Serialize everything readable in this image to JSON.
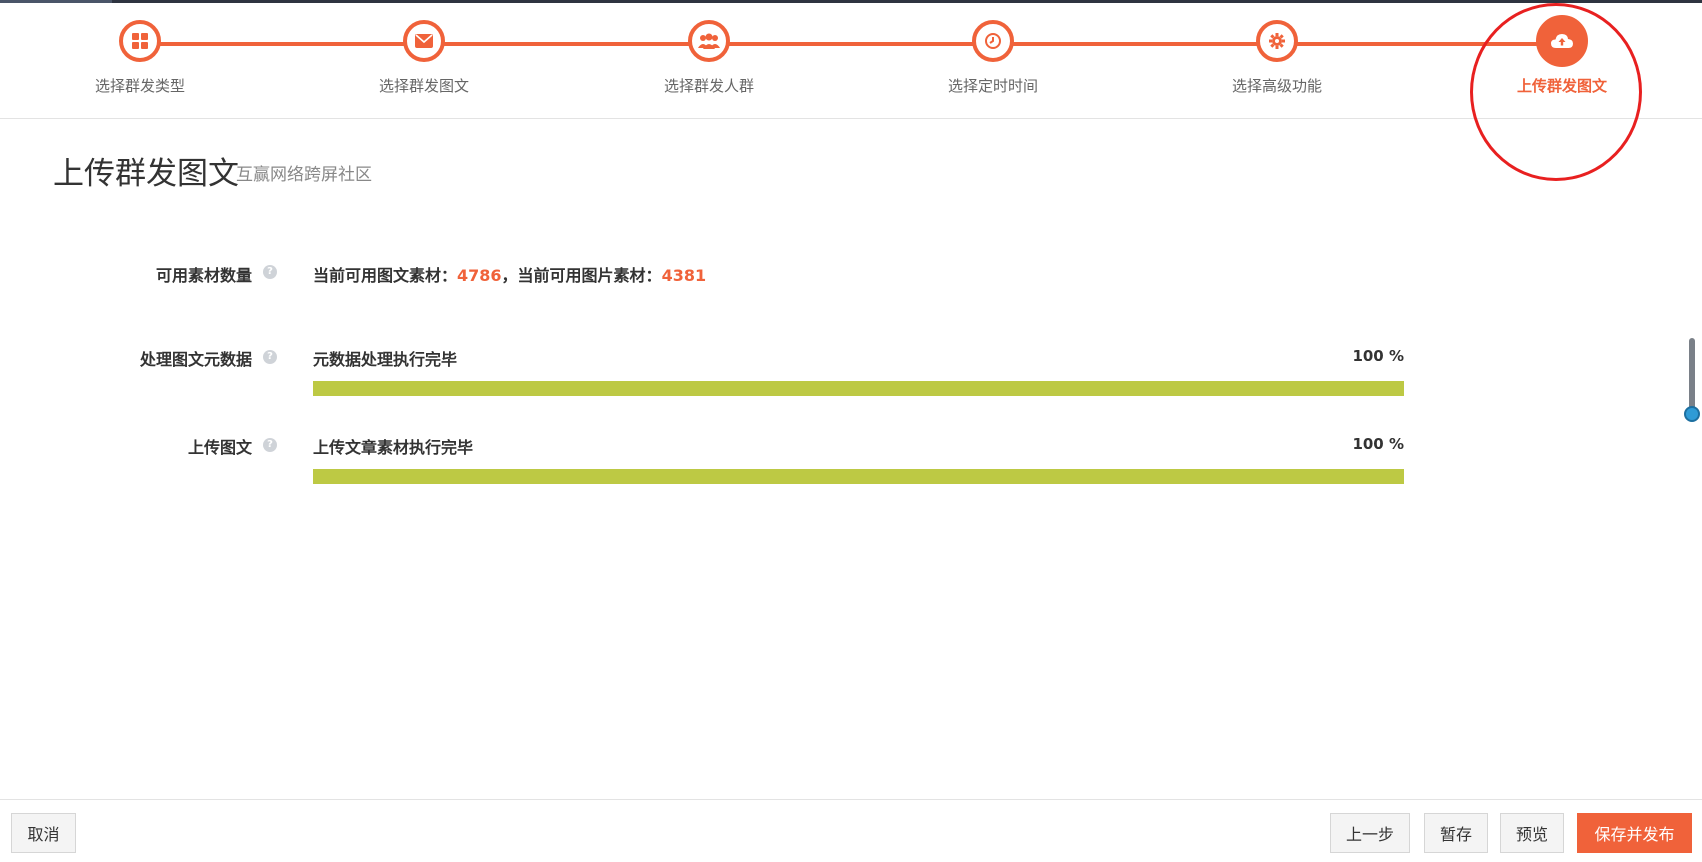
{
  "steps": [
    {
      "label": "选择群发类型",
      "icon": "grid-icon"
    },
    {
      "label": "选择群发图文",
      "icon": "envelope-icon"
    },
    {
      "label": "选择群发人群",
      "icon": "users-icon"
    },
    {
      "label": "选择定时时间",
      "icon": "clock-icon"
    },
    {
      "label": "选择高级功能",
      "icon": "gear-icon"
    },
    {
      "label": "上传群发图文",
      "icon": "cloud-upload-icon"
    }
  ],
  "active_step": 5,
  "page": {
    "title": "上传群发图文",
    "subtitle": "互赢网络跨屏社区"
  },
  "rows": {
    "available": {
      "label": "可用素材数量",
      "text_prefix": "当前可用图文素材：",
      "article_count": "4786",
      "text_middle": "，当前可用图片素材：",
      "image_count": "4381"
    },
    "metadata": {
      "label": "处理图文元数据",
      "status": "元数据处理执行完毕",
      "percent_text": "100 %",
      "progress": 1.0
    },
    "upload": {
      "label": "上传图文",
      "status": "上传文章素材执行完毕",
      "percent_text": "100 %",
      "progress": 1.0
    }
  },
  "footer": {
    "cancel": "取消",
    "prev": "上一步",
    "save_draft": "暂存",
    "preview": "预览",
    "publish": "保存并发布"
  },
  "colors": {
    "accent": "#f0623a",
    "progress": "#bdc944",
    "highlight_ring": "#e82020"
  }
}
